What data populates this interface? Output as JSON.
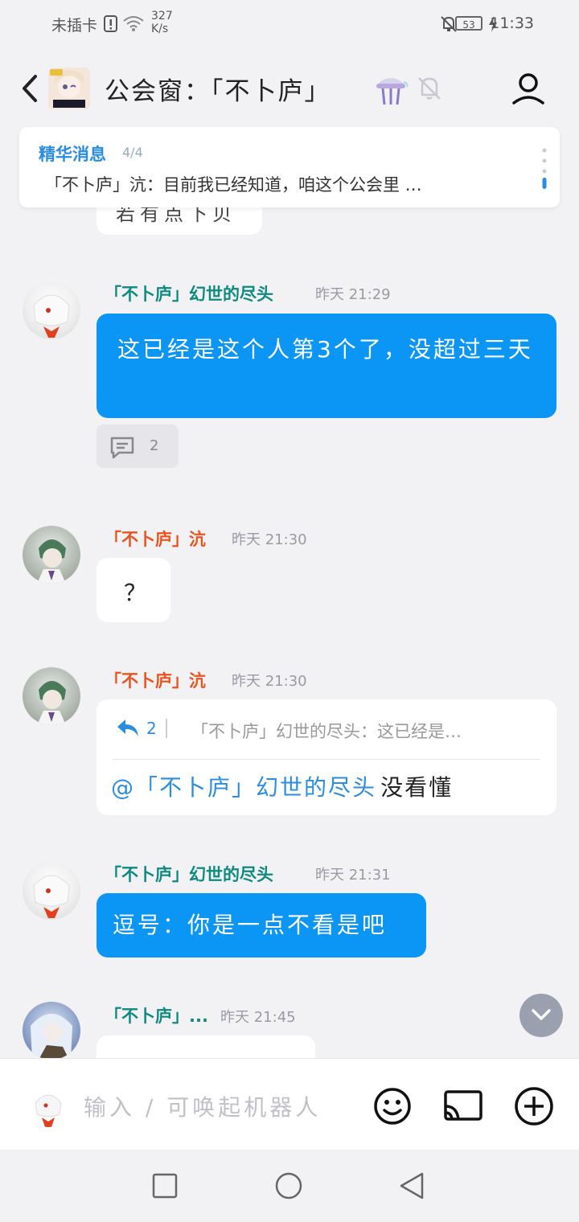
{
  "status_bar": {
    "carrier": "未插卡",
    "net_speed_value": "327",
    "net_speed_unit": "K/s",
    "battery": "53",
    "time": "11:33",
    "icons": [
      "sim-alert-icon",
      "wifi-icon",
      "mute-bell-icon",
      "battery-icon",
      "charging-icon"
    ]
  },
  "header": {
    "title": "公会窗：「不卜庐」",
    "icons": [
      "back-icon",
      "group-avatar",
      "flask-icon",
      "muted-bell-icon",
      "profile-icon"
    ]
  },
  "pinned": {
    "label": "精华消息",
    "count": "4/4",
    "text": "「不卜庐」沆：目前我已经知道，咱这个公会里 …",
    "partial_hidden_text": "若有点下贝"
  },
  "messages": [
    {
      "sender": "「不卜庐」幻世的尽头",
      "time": "昨天 21:29",
      "text": "这已经是这个人第3个了，没超过三天",
      "reply_count": "2"
    },
    {
      "sender": "「不卜庐」沆",
      "time": "昨天 21:30",
      "text": "？"
    },
    {
      "sender": "「不卜庐」沆",
      "time": "昨天 21:30",
      "quote_count": "2",
      "quote_text": "「不卜庐」幻世的尽头：这已经是…",
      "mention": "@「不卜庐」幻世的尽头",
      "text": "没看懂"
    },
    {
      "sender": "「不卜庐」幻世的尽头",
      "time": "昨天 21:31",
      "text": "逗号：你是一点不看是吧"
    },
    {
      "sender": "「不卜庐」...",
      "time": "昨天 21:45"
    }
  ],
  "input": {
    "placeholder": "输入 / 可唤起机器人"
  },
  "colors": {
    "accent_blue": "#0b95f5",
    "name_teal": "#0e8a80",
    "name_orange": "#e8541e",
    "link_blue": "#2a8de0"
  }
}
